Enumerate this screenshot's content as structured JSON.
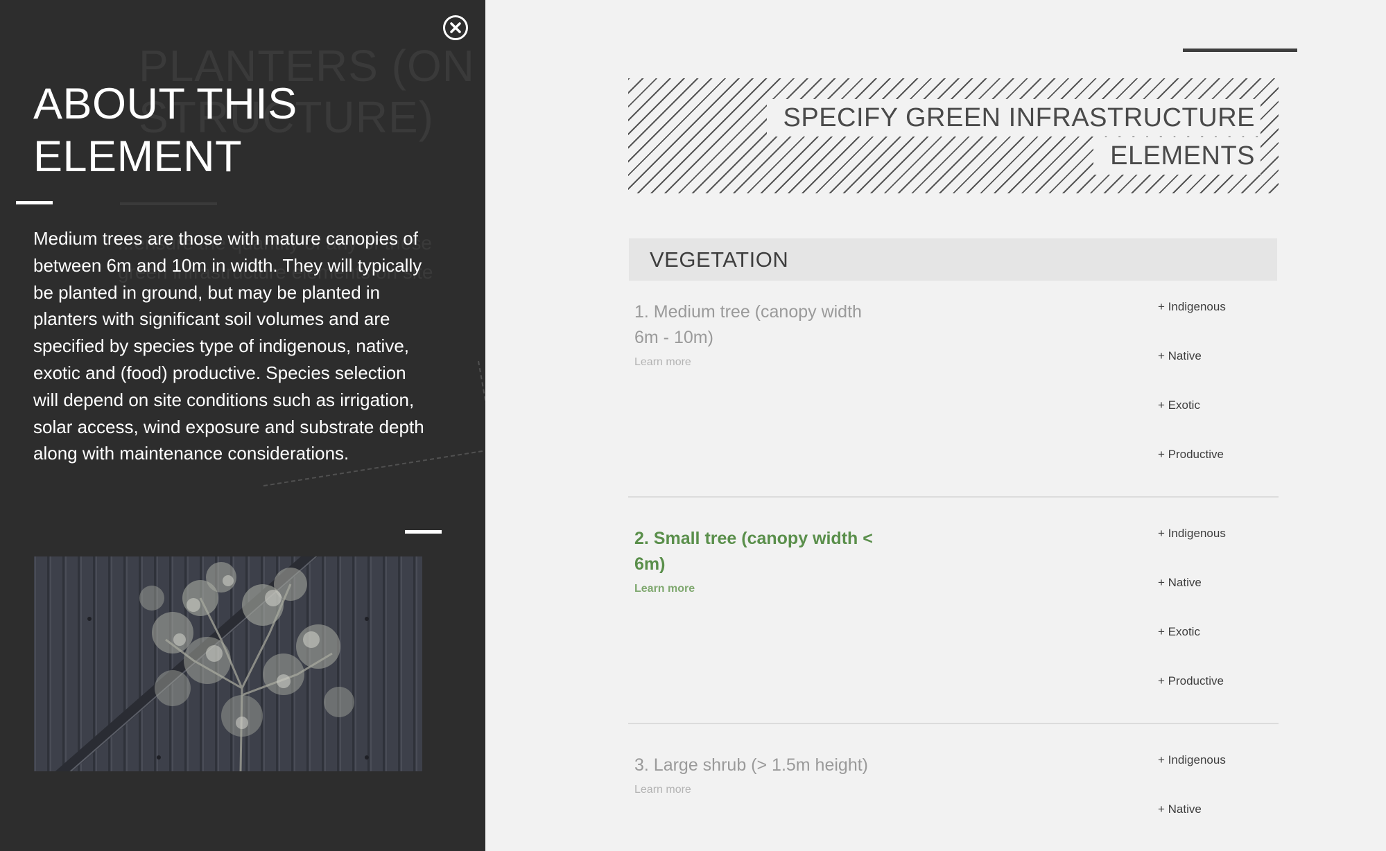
{
  "overlay": {
    "ghost_title": "PLANTERS (ON STRUCTURE)",
    "ghost_text": "...ensure the quantity of any of these green infrastructure elements on site",
    "title_line1": "ABOUT THIS",
    "title_line2": "ELEMENT",
    "description": "Medium trees are those with mature canopies of between 6m and 10m in width. They will typically be planted in ground, but may be planted in planters with significant soil volumes and are specified by species type of indigenous, native, exotic and (food) productive. Species selection will depend on site conditions such as irrigation, solar access, wind exposure and substrate depth along with maintenance considerations.",
    "close_icon": "close-circle-icon"
  },
  "header": {
    "title_line1": "SPECIFY GREEN INFRASTRUCTURE",
    "title_line2": "ELEMENTS"
  },
  "category": {
    "label": "VEGETATION"
  },
  "elements": [
    {
      "name_line1": "1. Medium tree (canopy width",
      "name_line2": "6m - 10m)",
      "learn_more": "Learn more",
      "options": [
        "+ Indigenous",
        "+ Native",
        "+ Exotic",
        "+ Productive"
      ],
      "active": false
    },
    {
      "name_line1": "2. Small tree (canopy width <",
      "name_line2": "6m)",
      "learn_more": "Learn more",
      "options": [
        "+ Indigenous",
        "+ Native",
        "+ Exotic",
        "+ Productive"
      ],
      "active": true
    },
    {
      "name_line1": "3. Large shrub (> 1.5m height)",
      "name_line2": "",
      "learn_more": "Learn more",
      "options": [
        "+ Indigenous",
        "+ Native"
      ],
      "active": false
    }
  ],
  "colors": {
    "panel_bg": "#2d2d2d",
    "page_bg": "#f2f2f2",
    "accent_green": "#5a8f4b",
    "text_dark": "#3e3e3e"
  }
}
